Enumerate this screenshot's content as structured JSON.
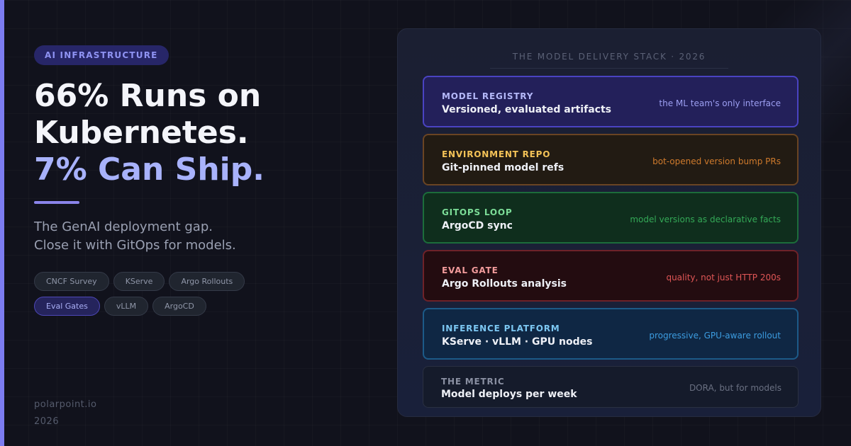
{
  "tag": "AI INFRASTRUCTURE",
  "headline": {
    "line1": "66% Runs on",
    "line2": "Kubernetes.",
    "line3": "7% Can Ship."
  },
  "subtitle": {
    "line1": "The GenAI deployment gap.",
    "line2": "Close it with GitOps for models."
  },
  "chips": [
    {
      "label": "CNCF Survey",
      "active": false
    },
    {
      "label": "KServe",
      "active": false
    },
    {
      "label": "Argo Rollouts",
      "active": false
    },
    {
      "label": "Eval Gates",
      "active": true
    },
    {
      "label": "vLLM",
      "active": false
    },
    {
      "label": "ArgoCD",
      "active": false
    }
  ],
  "footer": {
    "site": "polarpoint.io",
    "year": "2026"
  },
  "panel": {
    "title": "THE MODEL DELIVERY STACK · 2026",
    "layers": [
      {
        "name": "MODEL REGISTRY",
        "desc": "Versioned, evaluated artifacts",
        "note": "the ML team's only interface",
        "color": "#4a43c2"
      },
      {
        "name": "ENVIRONMENT REPO",
        "desc": "Git-pinned model refs",
        "note": "bot-opened version bump PRs",
        "color": "#6a4423"
      },
      {
        "name": "GITOPS LOOP",
        "desc": "ArgoCD sync",
        "note": "model versions as declarative facts",
        "color": "#1c6d3b"
      },
      {
        "name": "EVAL GATE",
        "desc": "Argo Rollouts analysis",
        "note": "quality, not just HTTP 200s",
        "color": "#6e2229"
      },
      {
        "name": "INFERENCE PLATFORM",
        "desc": "KServe · vLLM · GPU nodes",
        "note": "progressive, GPU-aware rollout",
        "color": "#1c5a88"
      },
      {
        "name": "THE METRIC",
        "desc": "Model deploys per week",
        "note": "DORA, but for models",
        "color": "#2a3042"
      }
    ]
  }
}
